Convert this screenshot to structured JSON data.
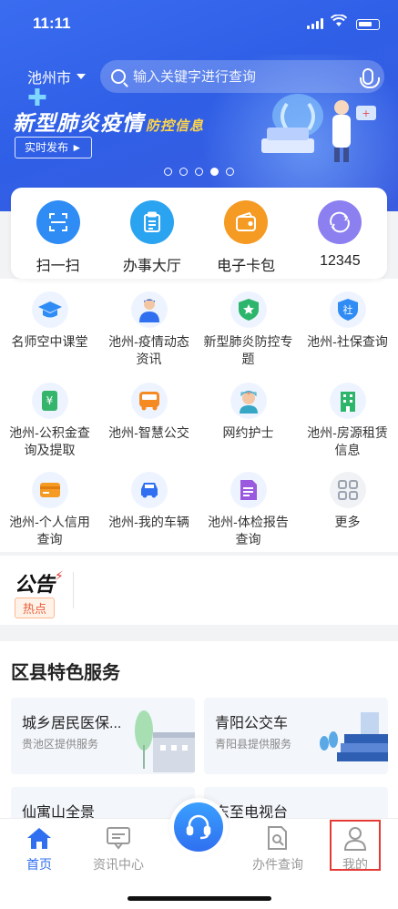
{
  "status_bar": {
    "time": "11:11"
  },
  "header": {
    "city": "池州市",
    "search_placeholder": "输入关键字进行查询"
  },
  "banner": {
    "title": "新型肺炎疫情",
    "title_suffix": "防控信息",
    "button": "实时发布 ►",
    "dot_count": 5,
    "active_dot": 4
  },
  "quick_actions": [
    {
      "label": "扫一扫",
      "icon": "scan-icon",
      "color": "#2f8cf5"
    },
    {
      "label": "办事大厅",
      "icon": "clipboard-icon",
      "color": "#2aa3f0"
    },
    {
      "label": "电子卡包",
      "icon": "wallet-icon",
      "color": "#f59a23"
    },
    {
      "label": "12345",
      "icon": "hotline-icon",
      "color": "#8c7ff0"
    }
  ],
  "services": [
    {
      "label": "名师空中课堂",
      "icon": "graduation-cap-icon",
      "color": "#2f8cf5"
    },
    {
      "label": "池州-疫情动态资讯",
      "icon": "doctor-icon",
      "color": "#2f6ff0"
    },
    {
      "label": "新型肺炎防控专题",
      "icon": "shield-star-icon",
      "color": "#2db56b"
    },
    {
      "label": "池州-社保查询",
      "icon": "shield-check-icon",
      "color": "#2f8cf5"
    },
    {
      "label": "池州-公积金查询及提取",
      "icon": "fund-icon",
      "color": "#35b56b"
    },
    {
      "label": "池州-智慧公交",
      "icon": "bus-icon",
      "color": "#f58a23"
    },
    {
      "label": "网约护士",
      "icon": "nurse-icon",
      "color": "#35a7c5"
    },
    {
      "label": "池州-房源租赁信息",
      "icon": "building-icon",
      "color": "#2db56b"
    },
    {
      "label": "池州-个人信用查询",
      "icon": "card-icon",
      "color": "#f59a23"
    },
    {
      "label": "池州-我的车辆",
      "icon": "car-icon",
      "color": "#2f6ff0"
    },
    {
      "label": "池州-体检报告查询",
      "icon": "report-icon",
      "color": "#9b59e0"
    },
    {
      "label": "更多",
      "icon": "grid-more-icon",
      "color": "#9aa3b0"
    }
  ],
  "notice": {
    "logo": "公告",
    "tag": "热点"
  },
  "district": {
    "title": "区县特色服务",
    "cards": [
      {
        "title": "城乡居民医保...",
        "subtitle": "贵池区提供服务"
      },
      {
        "title": "青阳公交车",
        "subtitle": "青阳县提供服务"
      },
      {
        "title": "仙寓山全景",
        "subtitle": ""
      },
      {
        "title": "东至电视台",
        "subtitle": ""
      }
    ]
  },
  "tabbar": {
    "items": [
      {
        "label": "首页",
        "icon": "home-icon",
        "active": true
      },
      {
        "label": "资讯中心",
        "icon": "message-icon",
        "active": false
      },
      {
        "label": "办件查询",
        "icon": "document-search-icon",
        "active": false
      },
      {
        "label": "我的",
        "icon": "user-icon",
        "active": false
      }
    ]
  }
}
